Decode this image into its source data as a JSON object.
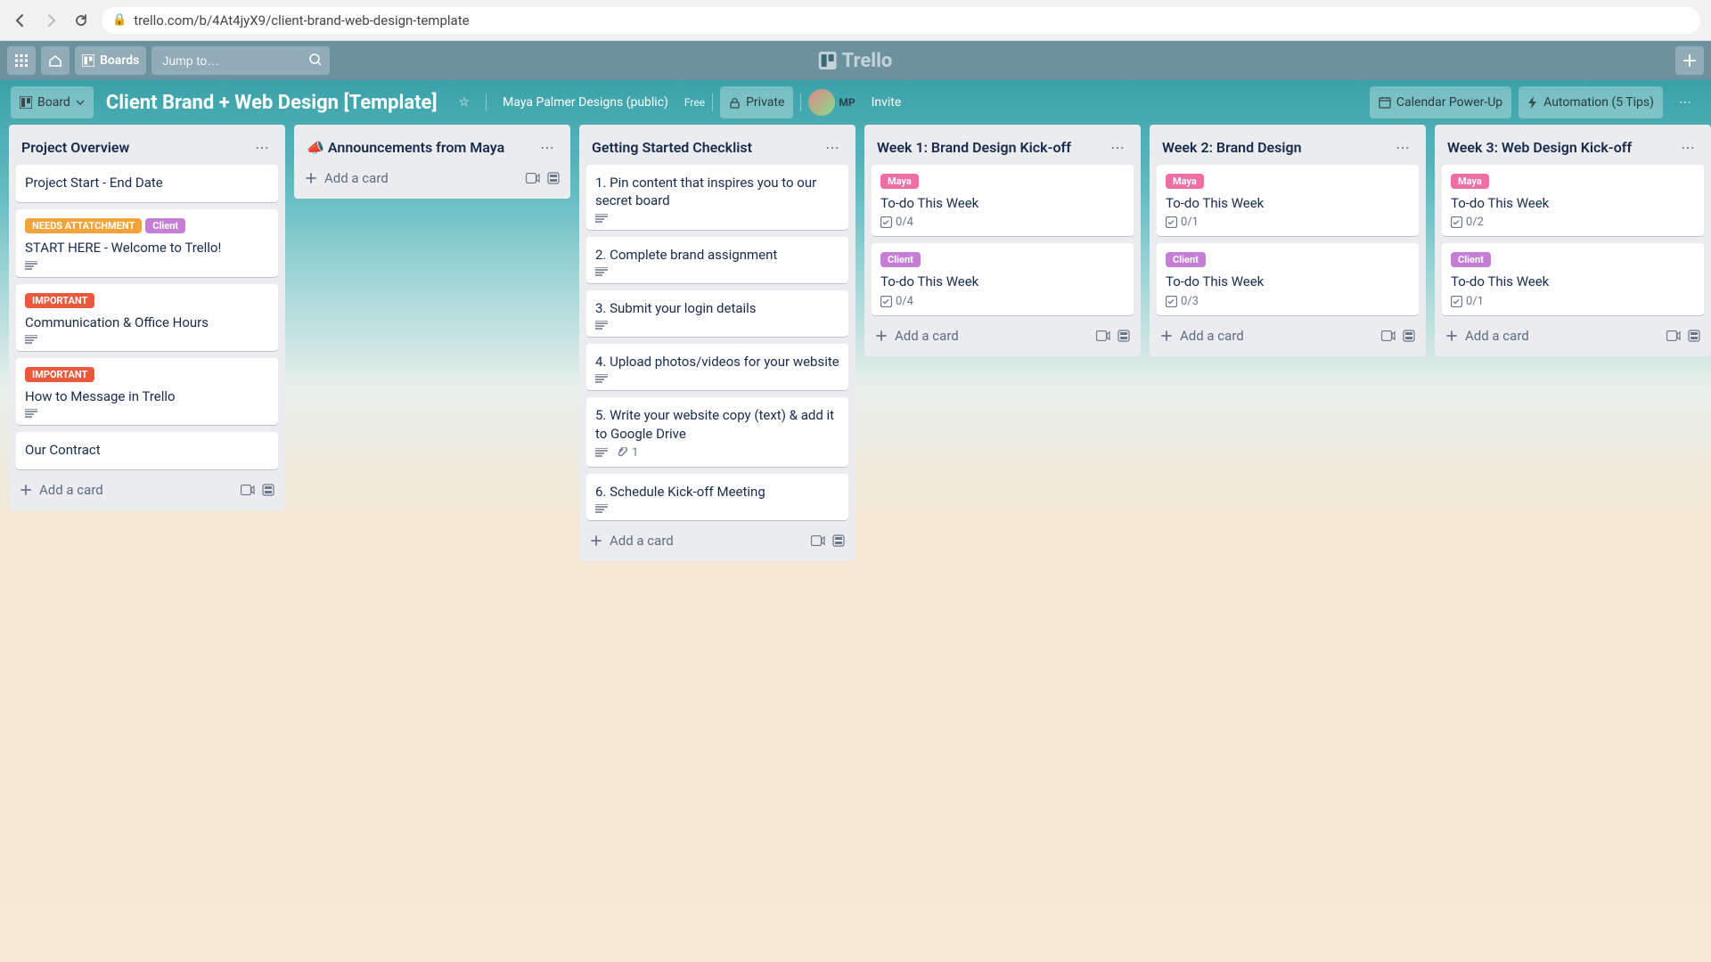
{
  "browser": {
    "url": "trello.com/b/4At4jyX9/client-brand-web-design-template"
  },
  "header": {
    "boards_label": "Boards",
    "search_placeholder": "Jump to…",
    "brand_label": "Trello"
  },
  "board_header": {
    "view_label": "Board",
    "title": "Client Brand + Web Design [Template]",
    "workspace": "Maya Palmer Designs (public)",
    "plan_label": "Free",
    "visibility_label": "Private",
    "member_initials": "MP",
    "invite_label": "Invite",
    "calendar_label": "Calendar Power-Up",
    "automation_label": "Automation (5 Tips)"
  },
  "add_card_label": "Add a card",
  "labels": {
    "needs_attachment": "NEEDS ATTATCHMENT",
    "client": "Client",
    "important": "IMPORTANT",
    "maya": "Maya"
  },
  "lists": [
    {
      "title": "Project Overview",
      "cards": [
        {
          "title": "Project Start - End Date"
        },
        {
          "title": "START HERE - Welcome to Trello!",
          "tags": [
            "needs_attachment",
            "client"
          ],
          "desc": true
        },
        {
          "title": "Communication & Office Hours",
          "tags": [
            "important"
          ],
          "desc": true
        },
        {
          "title": "How to Message in Trello",
          "tags": [
            "important"
          ],
          "desc": true
        },
        {
          "title": "Our Contract"
        }
      ]
    },
    {
      "title": "📣 Announcements from Maya",
      "cards": []
    },
    {
      "title": "Getting Started Checklist",
      "cards": [
        {
          "title": "1. Pin content that inspires you to our secret board",
          "desc": true
        },
        {
          "title": "2. Complete brand assignment",
          "desc": true
        },
        {
          "title": "3. Submit your login details",
          "desc": true
        },
        {
          "title": "4. Upload photos/videos for your website",
          "desc": true
        },
        {
          "title": "5. Write your website copy (text) & add it to Google Drive",
          "desc": true,
          "attach": "1"
        },
        {
          "title": "6. Schedule Kick-off Meeting",
          "desc": true
        }
      ]
    },
    {
      "title": "Week 1: Brand Design Kick-off",
      "cards": [
        {
          "title": "To-do This Week",
          "tags": [
            "maya"
          ],
          "check": "0/4"
        },
        {
          "title": "To-do This Week",
          "tags": [
            "client"
          ],
          "check": "0/4"
        }
      ]
    },
    {
      "title": "Week 2: Brand Design",
      "cards": [
        {
          "title": "To-do This Week",
          "tags": [
            "maya"
          ],
          "check": "0/1"
        },
        {
          "title": "To-do This Week",
          "tags": [
            "client"
          ],
          "check": "0/3"
        }
      ]
    },
    {
      "title": "Week 3: Web Design Kick-off",
      "cards": [
        {
          "title": "To-do This Week",
          "tags": [
            "maya"
          ],
          "check": "0/2"
        },
        {
          "title": "To-do This Week",
          "tags": [
            "client"
          ],
          "check": "0/1"
        }
      ]
    }
  ]
}
